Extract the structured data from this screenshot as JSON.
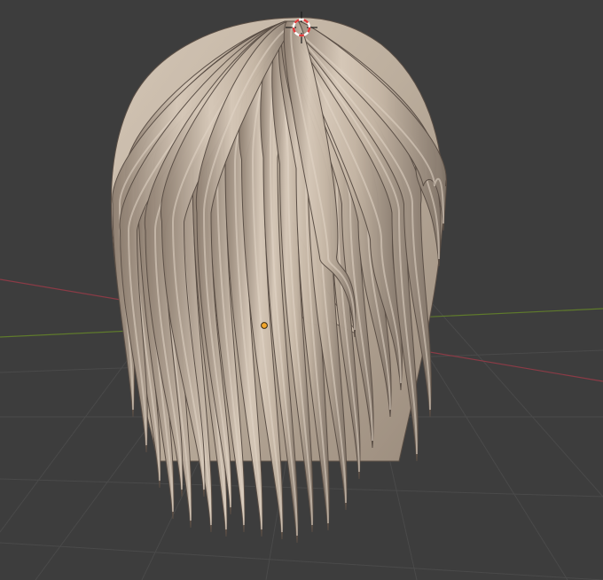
{
  "viewport": {
    "background": "#3d3d3d",
    "grid_color": "#4a4a4a",
    "axis_x_color": "#8a3b46",
    "axis_y_color": "#5f7a2c"
  },
  "mesh": {
    "name": "hair",
    "base_color": "#c2b3a2",
    "shadow_color": "#7d6f62",
    "highlight_color": "#e2d6c7",
    "edge_color": "#5a4e45",
    "strand_count": 26
  },
  "cursor": {
    "icon": "3d-cursor-icon",
    "ring_color_a": "#e23b3b",
    "ring_color_b": "#ffffff"
  },
  "origin": {
    "icon": "object-origin-icon",
    "color": "#f2a62c"
  }
}
